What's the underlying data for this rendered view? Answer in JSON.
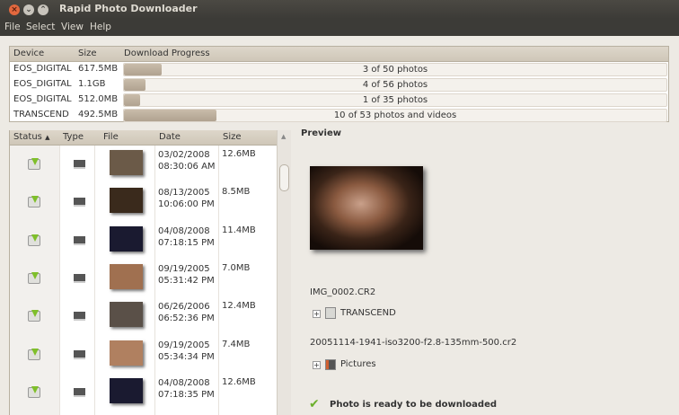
{
  "window": {
    "title": "Rapid Photo Downloader"
  },
  "menu": [
    "File",
    "Select",
    "View",
    "Help"
  ],
  "devices": {
    "headers": [
      "Device",
      "Size",
      "Download Progress"
    ],
    "rows": [
      {
        "device": "EOS_DIGITAL",
        "size": "617.5MB",
        "progress_text": "3 of 50 photos",
        "progress": 0.07
      },
      {
        "device": "EOS_DIGITAL",
        "size": "1.1GB",
        "progress_text": "4 of 56 photos",
        "progress": 0.04
      },
      {
        "device": "EOS_DIGITAL",
        "size": "512.0MB",
        "progress_text": "1 of 35 photos",
        "progress": 0.03
      },
      {
        "device": "TRANSCEND",
        "size": "492.5MB",
        "progress_text": "10 of 53 photos and videos",
        "progress": 0.17
      }
    ]
  },
  "files": {
    "headers": [
      "Status",
      "Type",
      "File",
      "Date",
      "Size"
    ],
    "sort_indicator": "▲",
    "rows": [
      {
        "date": "03/02/2008",
        "time": "08:30:06 AM",
        "size": "12.6MB",
        "thumb": "#6b5a48"
      },
      {
        "date": "08/13/2005",
        "time": "10:06:00 PM",
        "size": "8.5MB",
        "thumb": "#3a2a1c"
      },
      {
        "date": "04/08/2008",
        "time": "07:18:15 PM",
        "size": "11.4MB",
        "thumb": "#1a1a30"
      },
      {
        "date": "09/19/2005",
        "time": "05:31:42 PM",
        "size": "7.0MB",
        "thumb": "#a07050"
      },
      {
        "date": "06/26/2006",
        "time": "06:52:36 PM",
        "size": "12.4MB",
        "thumb": "#5a5048"
      },
      {
        "date": "09/19/2005",
        "time": "05:34:34 PM",
        "size": "7.4MB",
        "thumb": "#b08060"
      },
      {
        "date": "04/08/2008",
        "time": "07:18:35 PM",
        "size": "12.6MB",
        "thumb": "#1a1a30"
      }
    ]
  },
  "preview": {
    "label": "Preview",
    "filename": "IMG_0002.CR2",
    "source": "TRANSCEND",
    "dest_filename": "20051114-1941-iso3200-f2.8-135mm-500.cr2",
    "dest_folder": "Pictures",
    "status": "Photo is ready to be downloaded"
  }
}
